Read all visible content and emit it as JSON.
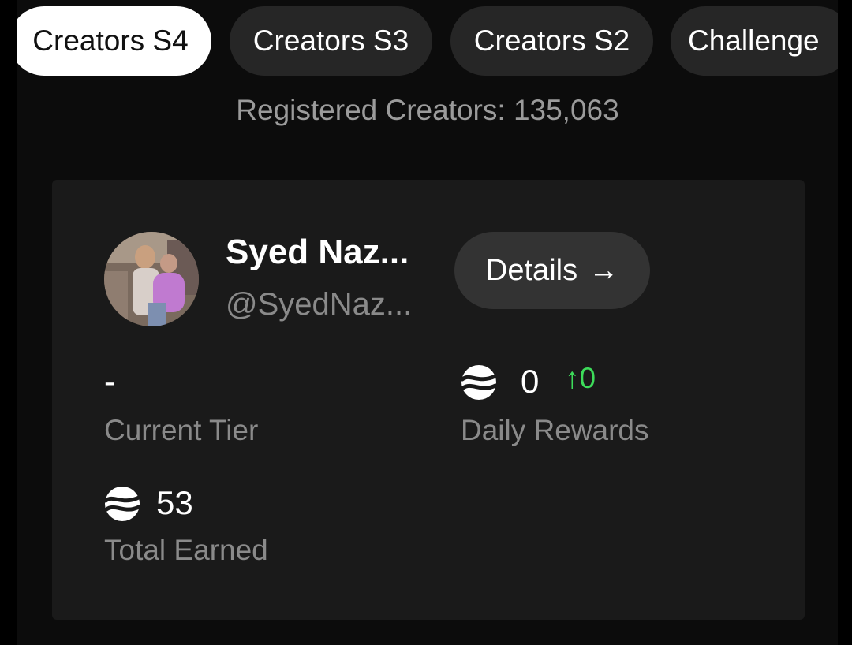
{
  "tabs": [
    {
      "label": "Creators S4",
      "active": true
    },
    {
      "label": "Creators S3",
      "active": false
    },
    {
      "label": "Creators S2",
      "active": false
    },
    {
      "label": "Challenge",
      "active": false
    }
  ],
  "registered_text": "Registered Creators: 135,063",
  "profile": {
    "name": "Syed Naz...",
    "handle": "@SyedNaz...",
    "details_label": "Details",
    "details_arrow": "→"
  },
  "stats": {
    "current_tier": {
      "value": "-",
      "label": "Current Tier"
    },
    "daily_rewards": {
      "value": "0",
      "delta": "↑0",
      "label": "Daily Rewards",
      "icon": "token-icon"
    },
    "total_earned": {
      "value": "53",
      "label": "Total Earned",
      "icon": "token-icon"
    }
  },
  "colors": {
    "background": "#0c0c0c",
    "card": "#1a1a1a",
    "active_tab": "#ffffff",
    "inactive_tab": "#262626",
    "positive": "#3ddc5a"
  }
}
